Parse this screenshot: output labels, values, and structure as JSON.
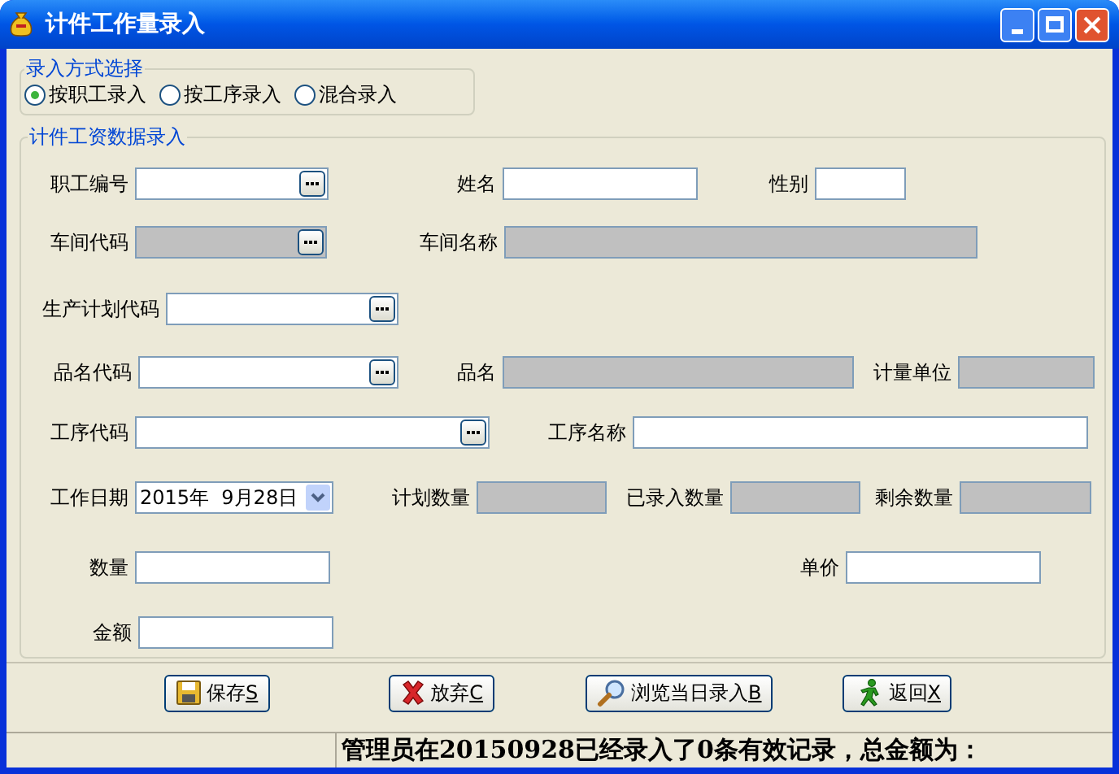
{
  "window": {
    "title": "计件工作量录入"
  },
  "entry_mode": {
    "title": "录入方式选择",
    "options": [
      {
        "label": "按职工录入",
        "selected": true
      },
      {
        "label": "按工序录入",
        "selected": false
      },
      {
        "label": "混合录入",
        "selected": false
      }
    ]
  },
  "data_entry": {
    "title": "计件工资数据录入",
    "lines": [
      {
        "fields": [
          {
            "label": "职工编号",
            "kind": "lookup",
            "disabled": false
          },
          {
            "label": "姓名",
            "kind": "text",
            "disabled": false
          },
          {
            "label": "性别",
            "kind": "text",
            "disabled": false
          }
        ]
      },
      {
        "fields": [
          {
            "label": "车间代码",
            "kind": "lookup",
            "disabled": true
          },
          {
            "label": "车间名称",
            "kind": "text",
            "disabled": true
          }
        ]
      },
      {
        "fields": [
          {
            "label": "生产计划代码",
            "kind": "lookup",
            "disabled": false
          }
        ]
      },
      {
        "fields": [
          {
            "label": "品名代码",
            "kind": "lookup",
            "disabled": false
          },
          {
            "label": "品名",
            "kind": "text",
            "disabled": true
          },
          {
            "label": "计量单位",
            "kind": "text",
            "disabled": true
          }
        ]
      },
      {
        "fields": [
          {
            "label": "工序代码",
            "kind": "lookup",
            "disabled": false
          },
          {
            "label": "工序名称",
            "kind": "text",
            "disabled": false
          }
        ]
      },
      {
        "fields": [
          {
            "label": "工作日期",
            "kind": "date",
            "disabled": false,
            "value": "2015年  9月28日"
          },
          {
            "label": "计划数量",
            "kind": "text",
            "disabled": true
          },
          {
            "label": "已录入数量",
            "kind": "text",
            "disabled": true
          },
          {
            "label": "剩余数量",
            "kind": "text",
            "disabled": true
          }
        ]
      },
      {
        "fields": [
          {
            "label": "数量",
            "kind": "text",
            "disabled": false
          },
          {
            "label": "单价",
            "kind": "text",
            "disabled": false
          }
        ]
      },
      {
        "fields": [
          {
            "label": "金额",
            "kind": "text",
            "disabled": false
          }
        ]
      }
    ]
  },
  "buttons": [
    {
      "label": "保存",
      "accelerator": "S",
      "kind": "save"
    },
    {
      "label": "放弃",
      "accelerator": "C",
      "kind": "cancel"
    },
    {
      "label": "浏览当日录入",
      "accelerator": "B",
      "kind": "browse"
    },
    {
      "label": "返回",
      "accelerator": "X",
      "kind": "exit"
    }
  ],
  "status_bar": {
    "message": "管理员在20150928已经录入了0条有效记录，总金额为："
  }
}
